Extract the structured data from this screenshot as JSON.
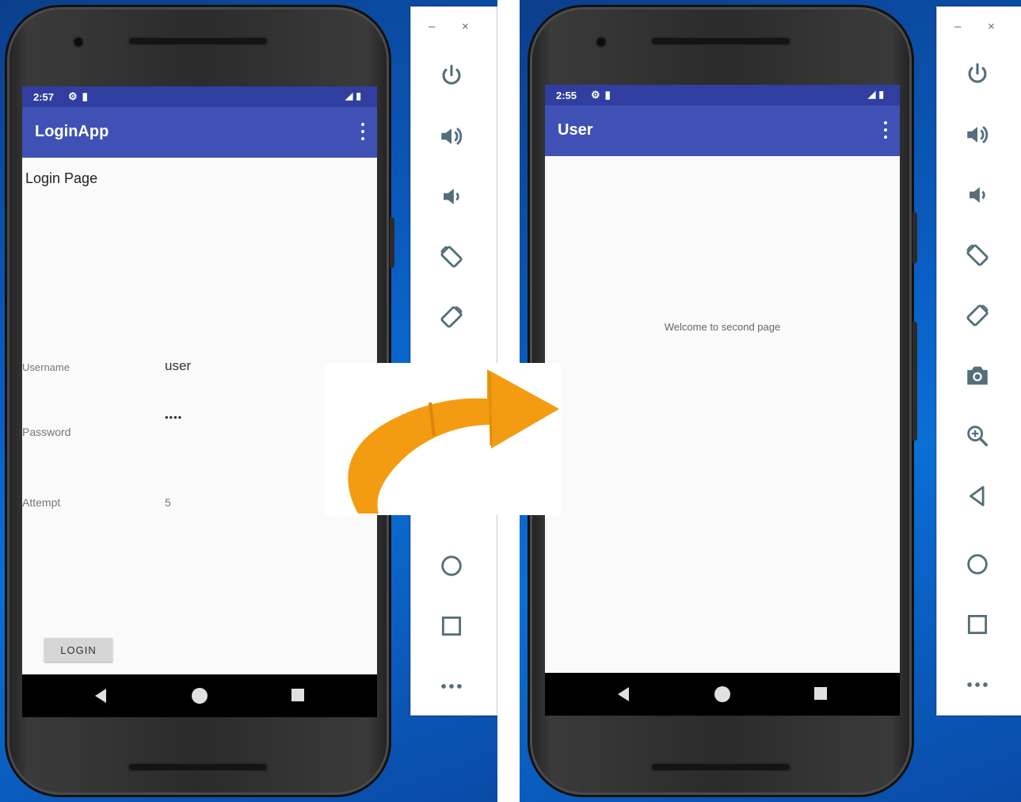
{
  "left_screen": {
    "status_time": "2:57",
    "app_title": "LoginApp",
    "heading": "Login Page",
    "username_label": "Username",
    "username_value": "user",
    "password_label": "Password",
    "password_value": "••••",
    "attempt_label": "Attempt",
    "attempt_value": "5",
    "login_button": "LOGIN"
  },
  "right_screen": {
    "status_time": "2:55",
    "app_title": "User",
    "welcome_text": "Welcome to second page"
  },
  "toolbar": {
    "minimize": "–",
    "close": "×",
    "buttons": [
      "power-icon",
      "volume-up-icon",
      "volume-down-icon",
      "rotate-left-icon",
      "rotate-right-icon",
      "camera-icon",
      "zoom-icon",
      "back-icon",
      "home-icon",
      "overview-icon",
      "more-icon"
    ]
  },
  "colors": {
    "status_bar": "#303f9f",
    "app_bar": "#3f51b5",
    "arrow": "#f39c12",
    "toolbar_icon": "#546e7a"
  }
}
